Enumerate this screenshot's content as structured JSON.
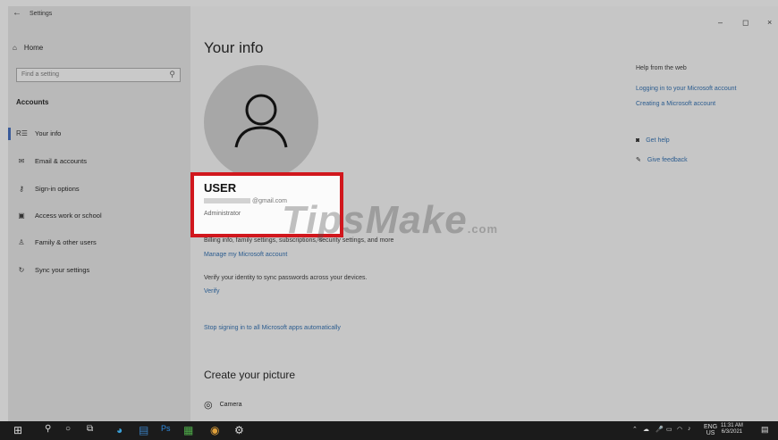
{
  "window": {
    "title": "Settings",
    "controls": {
      "minimize": "–",
      "maximize": "◻",
      "close": "×"
    }
  },
  "sidebar": {
    "home": "Home",
    "search_placeholder": "Find a setting",
    "section": "Accounts",
    "items": [
      {
        "label": "Your info",
        "icon": "person-card-icon",
        "selected": true
      },
      {
        "label": "Email & accounts",
        "icon": "email-icon"
      },
      {
        "label": "Sign-in options",
        "icon": "key-icon"
      },
      {
        "label": "Access work or school",
        "icon": "briefcase-icon"
      },
      {
        "label": "Family & other users",
        "icon": "people-icon"
      },
      {
        "label": "Sync your settings",
        "icon": "sync-icon"
      }
    ]
  },
  "main": {
    "title": "Your info",
    "user": {
      "name": "USER",
      "email_suffix": "@gmail.com",
      "role": "Administrator"
    },
    "billing_text": "Billing info, family settings, subscriptions, security settings, and more",
    "manage_link": "Manage my Microsoft account",
    "verify_text": "Verify your identity to sync passwords across your devices.",
    "verify_link": "Verify",
    "stop_link": "Stop signing in to all Microsoft apps automatically",
    "create_picture": "Create your picture",
    "camera": "Camera"
  },
  "help": {
    "title": "Help from the web",
    "links": [
      "Logging in to your Microsoft account",
      "Creating a Microsoft account"
    ],
    "get_help": "Get help",
    "feedback": "Give feedback"
  },
  "watermark": {
    "text": "TipsMake",
    "suffix": ".com"
  },
  "taskbar": {
    "lang_top": "ENG",
    "lang_bottom": "US",
    "time": "11:31 AM",
    "date": "6/3/2021"
  },
  "colors": {
    "accent": "#2b5c8f",
    "highlight": "#d1171d",
    "taskbar": "#1b1b1b"
  }
}
